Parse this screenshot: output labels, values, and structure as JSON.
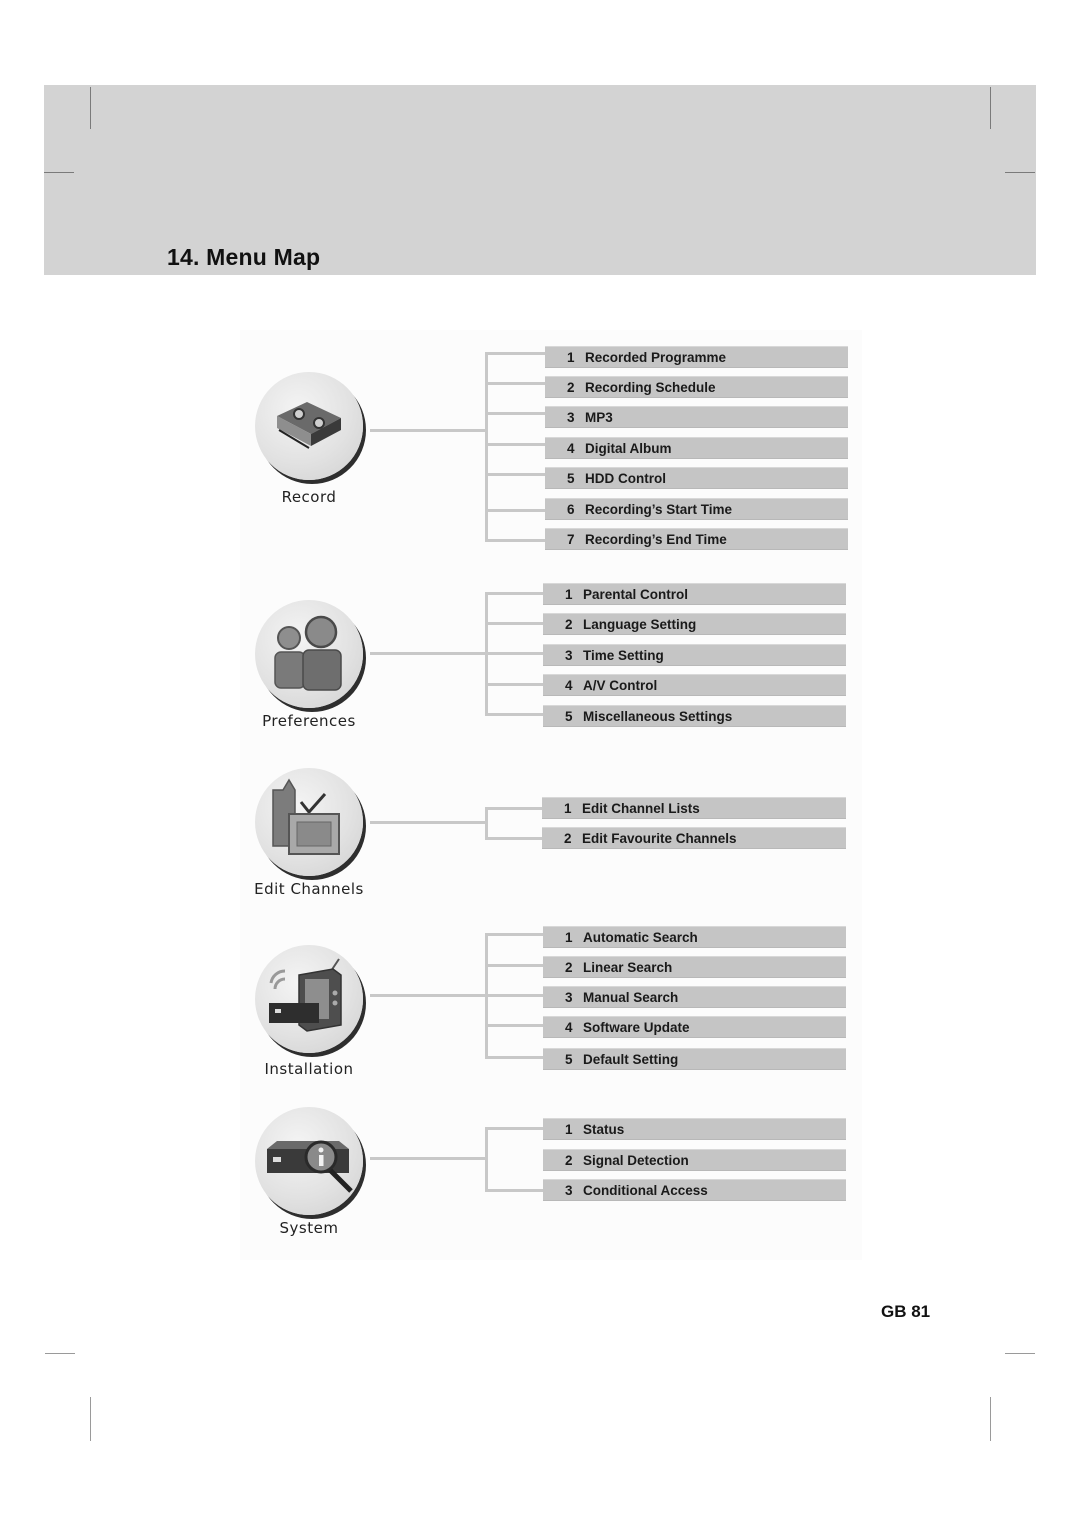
{
  "page": {
    "title": "14. Menu Map",
    "page_number": "GB 81"
  },
  "menu_map": [
    {
      "name": "Record",
      "icon": "video-cassette-icon",
      "items": [
        {
          "num": "1",
          "label": "Recorded Programme"
        },
        {
          "num": "2",
          "label": "Recording Schedule"
        },
        {
          "num": "3",
          "label": "MP3"
        },
        {
          "num": "4",
          "label": "Digital Album"
        },
        {
          "num": "5",
          "label": "HDD Control"
        },
        {
          "num": "6",
          "label": "Recording’s Start Time"
        },
        {
          "num": "7",
          "label": "Recording’s End Time"
        }
      ]
    },
    {
      "name": "Preferences",
      "icon": "users-icon",
      "items": [
        {
          "num": "1",
          "label": "Parental Control"
        },
        {
          "num": "2",
          "label": "Language Setting"
        },
        {
          "num": "3",
          "label": "Time Setting"
        },
        {
          "num": "4",
          "label": "A/V Control"
        },
        {
          "num": "5",
          "label": "Miscellaneous Settings"
        }
      ]
    },
    {
      "name": "Edit Channels",
      "icon": "tv-checklist-icon",
      "items": [
        {
          "num": "1",
          "label": "Edit Channel Lists"
        },
        {
          "num": "2",
          "label": "Edit Favourite Channels"
        }
      ]
    },
    {
      "name": "Installation",
      "icon": "tv-receiver-icon",
      "items": [
        {
          "num": "1",
          "label": "Automatic Search"
        },
        {
          "num": "2",
          "label": "Linear Search"
        },
        {
          "num": "3",
          "label": "Manual Search"
        },
        {
          "num": "4",
          "label": "Software Update"
        },
        {
          "num": "5",
          "label": "Default Setting"
        }
      ]
    },
    {
      "name": "System",
      "icon": "receiver-info-icon",
      "items": [
        {
          "num": "1",
          "label": "Status"
        },
        {
          "num": "2",
          "label": "Signal Detection"
        },
        {
          "num": "3",
          "label": "Conditional Access"
        }
      ]
    }
  ]
}
